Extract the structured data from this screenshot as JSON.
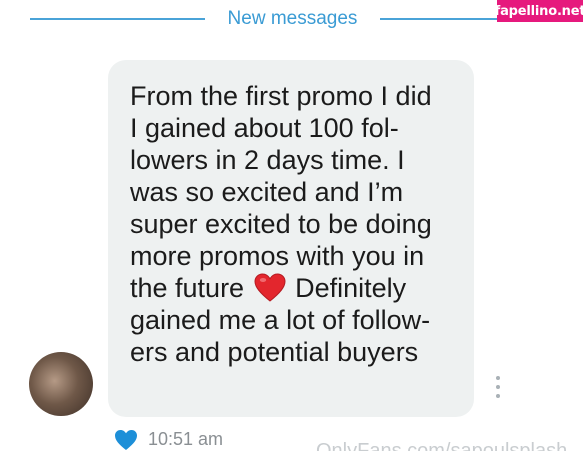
{
  "divider": {
    "label": "New messages"
  },
  "watermark": {
    "text": "fapellino.net"
  },
  "message": {
    "lines": [
      "From the first promo I did",
      "I gained about 100 fol-",
      "lowers in 2 days time. I",
      "was so excited and I’m",
      "super excited to be doing",
      "more promos with you in",
      "the future",
      "Definitely",
      "gained me a lot of follow-",
      "ers and potential buyers"
    ],
    "emoji": "red-heart"
  },
  "footer": {
    "time": "10:51 am",
    "url": "OnlyFans.com/sapoulsplash",
    "liked_icon": "heart-icon",
    "accent": "#1d8fd8"
  },
  "colors": {
    "accent": "#3a9bd4",
    "bubble": "#eef1f1",
    "watermark": "#e6197d"
  }
}
